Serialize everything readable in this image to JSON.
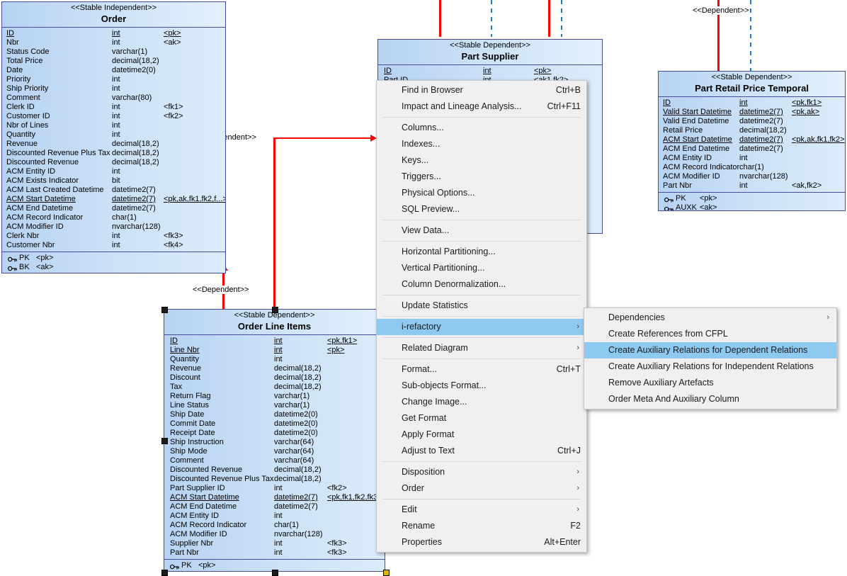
{
  "entities": [
    {
      "id": "order",
      "stereotype": "<<Stable Independent>>",
      "name": "Order",
      "attributes": [
        {
          "name": "ID",
          "type": "int",
          "keys": "<pk>",
          "underline": true
        },
        {
          "name": "Nbr",
          "type": "int",
          "keys": "<ak>",
          "underline": false
        },
        {
          "name": "Status Code",
          "type": "varchar(1)",
          "keys": "",
          "underline": false
        },
        {
          "name": "Total Price",
          "type": "decimal(18,2)",
          "keys": "",
          "underline": false
        },
        {
          "name": "Date",
          "type": "datetime2(0)",
          "keys": "",
          "underline": false
        },
        {
          "name": "Priority",
          "type": "int",
          "keys": "",
          "underline": false
        },
        {
          "name": "Ship Priority",
          "type": "int",
          "keys": "",
          "underline": false
        },
        {
          "name": "Comment",
          "type": "varchar(80)",
          "keys": "",
          "underline": false
        },
        {
          "name": "Clerk ID",
          "type": "int",
          "keys": "<fk1>",
          "underline": false
        },
        {
          "name": "Customer ID",
          "type": "int",
          "keys": "<fk2>",
          "underline": false
        },
        {
          "name": "Nbr of Lines",
          "type": "int",
          "keys": "",
          "underline": false
        },
        {
          "name": "Quantity",
          "type": "int",
          "keys": "",
          "underline": false
        },
        {
          "name": "Revenue",
          "type": "decimal(18,2)",
          "keys": "",
          "underline": false
        },
        {
          "name": "Discounted Revenue Plus Tax",
          "type": "decimal(18,2)",
          "keys": "",
          "underline": false
        },
        {
          "name": "Discounted Revenue",
          "type": "decimal(18,2)",
          "keys": "",
          "underline": false
        },
        {
          "name": "ACM Entity ID",
          "type": "int",
          "keys": "",
          "underline": false
        },
        {
          "name": "ACM Exists Indicator",
          "type": "bit",
          "keys": "",
          "underline": false
        },
        {
          "name": "ACM Last Created Datetime",
          "type": "datetime2(7)",
          "keys": "",
          "underline": false
        },
        {
          "name": "ACM Start Datetime",
          "type": "datetime2(7)",
          "keys": "<pk,ak,fk1,fk2,f...>",
          "underline": true
        },
        {
          "name": "ACM End Datetime",
          "type": "datetime2(7)",
          "keys": "",
          "underline": false
        },
        {
          "name": "ACM Record Indicator",
          "type": "char(1)",
          "keys": "",
          "underline": false
        },
        {
          "name": "ACM Modifier ID",
          "type": "nvarchar(128)",
          "keys": "",
          "underline": false
        },
        {
          "name": "Clerk Nbr",
          "type": "int",
          "keys": "<fk3>",
          "underline": false
        },
        {
          "name": "Customer Nbr",
          "type": "int",
          "keys": "<fk4>",
          "underline": false
        }
      ],
      "keys": [
        {
          "name": "PK",
          "value": "<pk>"
        },
        {
          "name": "BK",
          "value": "<ak>"
        }
      ]
    },
    {
      "id": "part_supplier",
      "stereotype": "<<Stable Dependent>>",
      "name": "Part Supplier",
      "attributes": [
        {
          "name": "ID",
          "type": "int",
          "keys": "<pk>",
          "underline": true
        },
        {
          "name": "Part ID",
          "type": "int",
          "keys": "<ak1,fk2>",
          "underline": false
        }
      ],
      "keys": []
    },
    {
      "id": "part_retail_price_temporal",
      "stereotype": "<<Stable Dependent>>",
      "name": "Part Retail Price Temporal",
      "attributes": [
        {
          "name": "ID",
          "type": "int",
          "keys": "<pk,fk1>",
          "underline": true
        },
        {
          "name": "Valid Start Datetime",
          "type": "datetime2(7)",
          "keys": "<pk,ak>",
          "underline": true
        },
        {
          "name": "Valid End Datetime",
          "type": "datetime2(7)",
          "keys": "",
          "underline": false
        },
        {
          "name": "Retail Price",
          "type": "decimal(18,2)",
          "keys": "",
          "underline": false
        },
        {
          "name": "ACM Start Datetime",
          "type": "datetime2(7)",
          "keys": "<pk,ak,fk1,fk2>",
          "underline": true
        },
        {
          "name": "ACM End Datetime",
          "type": "datetime2(7)",
          "keys": "",
          "underline": false
        },
        {
          "name": "ACM Entity ID",
          "type": "int",
          "keys": "",
          "underline": false
        },
        {
          "name": "ACM Record Indicator",
          "type": "char(1)",
          "keys": "",
          "underline": false
        },
        {
          "name": "ACM Modifier ID",
          "type": "nvarchar(128)",
          "keys": "",
          "underline": false
        },
        {
          "name": "Part Nbr",
          "type": "int",
          "keys": "<ak,fk2>",
          "underline": false
        }
      ],
      "keys": [
        {
          "name": "PK",
          "value": "<pk>"
        },
        {
          "name": "AUXK",
          "value": "<ak>"
        }
      ]
    },
    {
      "id": "order_line_items",
      "stereotype": "<<Stable Dependent>>",
      "name": "Order Line Items",
      "attributes": [
        {
          "name": "ID",
          "type": "int",
          "keys": "<pk,fk1>",
          "underline": true
        },
        {
          "name": "Line Nbr",
          "type": "int",
          "keys": "<pk>",
          "underline": true
        },
        {
          "name": "Quantity",
          "type": "int",
          "keys": "",
          "underline": false
        },
        {
          "name": "Revenue",
          "type": "decimal(18,2)",
          "keys": "",
          "underline": false
        },
        {
          "name": "Discount",
          "type": "decimal(18,2)",
          "keys": "",
          "underline": false
        },
        {
          "name": "Tax",
          "type": "decimal(18,2)",
          "keys": "",
          "underline": false
        },
        {
          "name": "Return Flag",
          "type": "varchar(1)",
          "keys": "",
          "underline": false
        },
        {
          "name": "Line Status",
          "type": "varchar(1)",
          "keys": "",
          "underline": false
        },
        {
          "name": "Ship Date",
          "type": "datetime2(0)",
          "keys": "",
          "underline": false
        },
        {
          "name": "Commit Date",
          "type": "datetime2(0)",
          "keys": "",
          "underline": false
        },
        {
          "name": "Receipt Date",
          "type": "datetime2(0)",
          "keys": "",
          "underline": false
        },
        {
          "name": "Ship Instruction",
          "type": "varchar(64)",
          "keys": "",
          "underline": false
        },
        {
          "name": "Ship Mode",
          "type": "varchar(64)",
          "keys": "",
          "underline": false
        },
        {
          "name": "Comment",
          "type": "varchar(64)",
          "keys": "",
          "underline": false
        },
        {
          "name": "Discounted Revenue",
          "type": "decimal(18,2)",
          "keys": "",
          "underline": false
        },
        {
          "name": "Discounted Revenue Plus Tax",
          "type": "decimal(18,2)",
          "keys": "",
          "underline": false
        },
        {
          "name": "Part Supplier ID",
          "type": "int",
          "keys": "<fk2>",
          "underline": false
        },
        {
          "name": "ACM Start Datetime",
          "type": "datetime2(7)",
          "keys": "<pk,fk1,fk2,fk3>",
          "underline": true
        },
        {
          "name": "ACM End Datetime",
          "type": "datetime2(7)",
          "keys": "",
          "underline": false
        },
        {
          "name": "ACM Entity ID",
          "type": "int",
          "keys": "",
          "underline": false
        },
        {
          "name": "ACM Record Indicator",
          "type": "char(1)",
          "keys": "",
          "underline": false
        },
        {
          "name": "ACM Modifier ID",
          "type": "nvarchar(128)",
          "keys": "",
          "underline": false
        },
        {
          "name": "Supplier Nbr",
          "type": "int",
          "keys": "<fk3>",
          "underline": false
        },
        {
          "name": "Part Nbr",
          "type": "int",
          "keys": "<fk3>",
          "underline": false
        }
      ],
      "keys": [
        {
          "name": "PK",
          "value": "<pk>"
        }
      ]
    }
  ],
  "relationship_labels": {
    "independent": "<<Independent>>",
    "dependent_left": "<<Dependent>>",
    "dependent_right": "<<Dependent>>"
  },
  "context_menu": {
    "items": [
      {
        "label": "Find in Browser",
        "accel": "Ctrl+B",
        "arrow": false,
        "selected": false,
        "sep_after": false
      },
      {
        "label": "Impact and Lineage Analysis...",
        "accel": "Ctrl+F11",
        "arrow": false,
        "selected": false,
        "sep_after": true
      },
      {
        "label": "Columns...",
        "accel": "",
        "arrow": false,
        "selected": false,
        "sep_after": false
      },
      {
        "label": "Indexes...",
        "accel": "",
        "arrow": false,
        "selected": false,
        "sep_after": false
      },
      {
        "label": "Keys...",
        "accel": "",
        "arrow": false,
        "selected": false,
        "sep_after": false
      },
      {
        "label": "Triggers...",
        "accel": "",
        "arrow": false,
        "selected": false,
        "sep_after": false
      },
      {
        "label": "Physical Options...",
        "accel": "",
        "arrow": false,
        "selected": false,
        "sep_after": false
      },
      {
        "label": "SQL Preview...",
        "accel": "",
        "arrow": false,
        "selected": false,
        "sep_after": true
      },
      {
        "label": "View Data...",
        "accel": "",
        "arrow": false,
        "selected": false,
        "sep_after": true
      },
      {
        "label": "Horizontal Partitioning...",
        "accel": "",
        "arrow": false,
        "selected": false,
        "sep_after": false
      },
      {
        "label": "Vertical Partitioning...",
        "accel": "",
        "arrow": false,
        "selected": false,
        "sep_after": false
      },
      {
        "label": "Column Denormalization...",
        "accel": "",
        "arrow": false,
        "selected": false,
        "sep_after": true
      },
      {
        "label": "Update Statistics",
        "accel": "",
        "arrow": false,
        "selected": false,
        "sep_after": true
      },
      {
        "label": "i-refactory",
        "accel": "",
        "arrow": true,
        "selected": true,
        "sep_after": true
      },
      {
        "label": "Related Diagram",
        "accel": "",
        "arrow": true,
        "selected": false,
        "sep_after": true
      },
      {
        "label": "Format...",
        "accel": "Ctrl+T",
        "arrow": false,
        "selected": false,
        "sep_after": false
      },
      {
        "label": "Sub-objects Format...",
        "accel": "",
        "arrow": false,
        "selected": false,
        "sep_after": false
      },
      {
        "label": "Change Image...",
        "accel": "",
        "arrow": false,
        "selected": false,
        "sep_after": false
      },
      {
        "label": "Get Format",
        "accel": "",
        "arrow": false,
        "selected": false,
        "sep_after": false
      },
      {
        "label": "Apply Format",
        "accel": "",
        "arrow": false,
        "selected": false,
        "sep_after": false
      },
      {
        "label": "Adjust to Text",
        "accel": "Ctrl+J",
        "arrow": false,
        "selected": false,
        "sep_after": true
      },
      {
        "label": "Disposition",
        "accel": "",
        "arrow": true,
        "selected": false,
        "sep_after": false
      },
      {
        "label": "Order",
        "accel": "",
        "arrow": true,
        "selected": false,
        "sep_after": true
      },
      {
        "label": "Edit",
        "accel": "",
        "arrow": true,
        "selected": false,
        "sep_after": false
      },
      {
        "label": "Rename",
        "accel": "F2",
        "arrow": false,
        "selected": false,
        "sep_after": false
      },
      {
        "label": "Properties",
        "accel": "Alt+Enter",
        "arrow": false,
        "selected": false,
        "sep_after": false
      }
    ]
  },
  "submenu": {
    "items": [
      {
        "label": "Dependencies",
        "accel": "",
        "arrow": true,
        "selected": false
      },
      {
        "label": "Create References from CFPL",
        "accel": "",
        "arrow": false,
        "selected": false
      },
      {
        "label": "Create Auxiliary Relations for Dependent Relations",
        "accel": "",
        "arrow": false,
        "selected": true
      },
      {
        "label": "Create Auxiliary Relations for Independent Relations",
        "accel": "",
        "arrow": false,
        "selected": false
      },
      {
        "label": "Remove Auxiliary Artefacts",
        "accel": "",
        "arrow": false,
        "selected": false
      },
      {
        "label": "Order Meta And Auxiliary Column",
        "accel": "",
        "arrow": false,
        "selected": false
      }
    ]
  },
  "colors": {
    "entity_fill": "#c9e0f7",
    "entity_border": "#4a4aa0",
    "relation_red": "#ff0000",
    "relation_blue": "#1a7ad4",
    "menu_bg": "#f0f0f0",
    "menu_highlight": "#8ec9f0"
  },
  "icons": {
    "key": "key-icon",
    "submenu_arrow": "chevron-right-icon"
  }
}
